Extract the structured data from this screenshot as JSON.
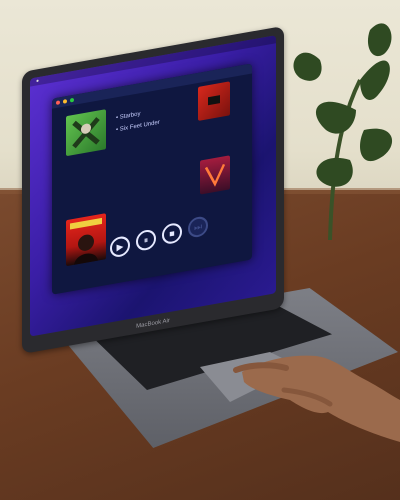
{
  "scene": {
    "laptop_brand": "MacBook Air"
  },
  "menubar": {
    "items": [
      "",
      "",
      ""
    ]
  },
  "player": {
    "window_title": "",
    "now_playing": [
      {
        "title": "Starboy"
      },
      {
        "title": "Six Feet Under"
      }
    ],
    "bottom_caption_lines": [
      "",
      ""
    ],
    "albums": [
      {
        "name": "green album",
        "colors": [
          "#59b84a",
          "#2b6e2b"
        ]
      },
      {
        "name": "red album",
        "colors": [
          "#d22a1f",
          "#8a1410"
        ]
      },
      {
        "name": "starboy album",
        "colors": [
          "#e0201a",
          "#1a0c0c"
        ]
      },
      {
        "name": "neon album",
        "colors": [
          "#a11b40",
          "#ff6a3a"
        ]
      }
    ],
    "controls": [
      {
        "name": "play-button",
        "glyph": "▶"
      },
      {
        "name": "pause-button",
        "glyph": "⏸"
      },
      {
        "name": "stop-button",
        "glyph": "■"
      },
      {
        "name": "next-button",
        "glyph": "⏭"
      }
    ]
  }
}
